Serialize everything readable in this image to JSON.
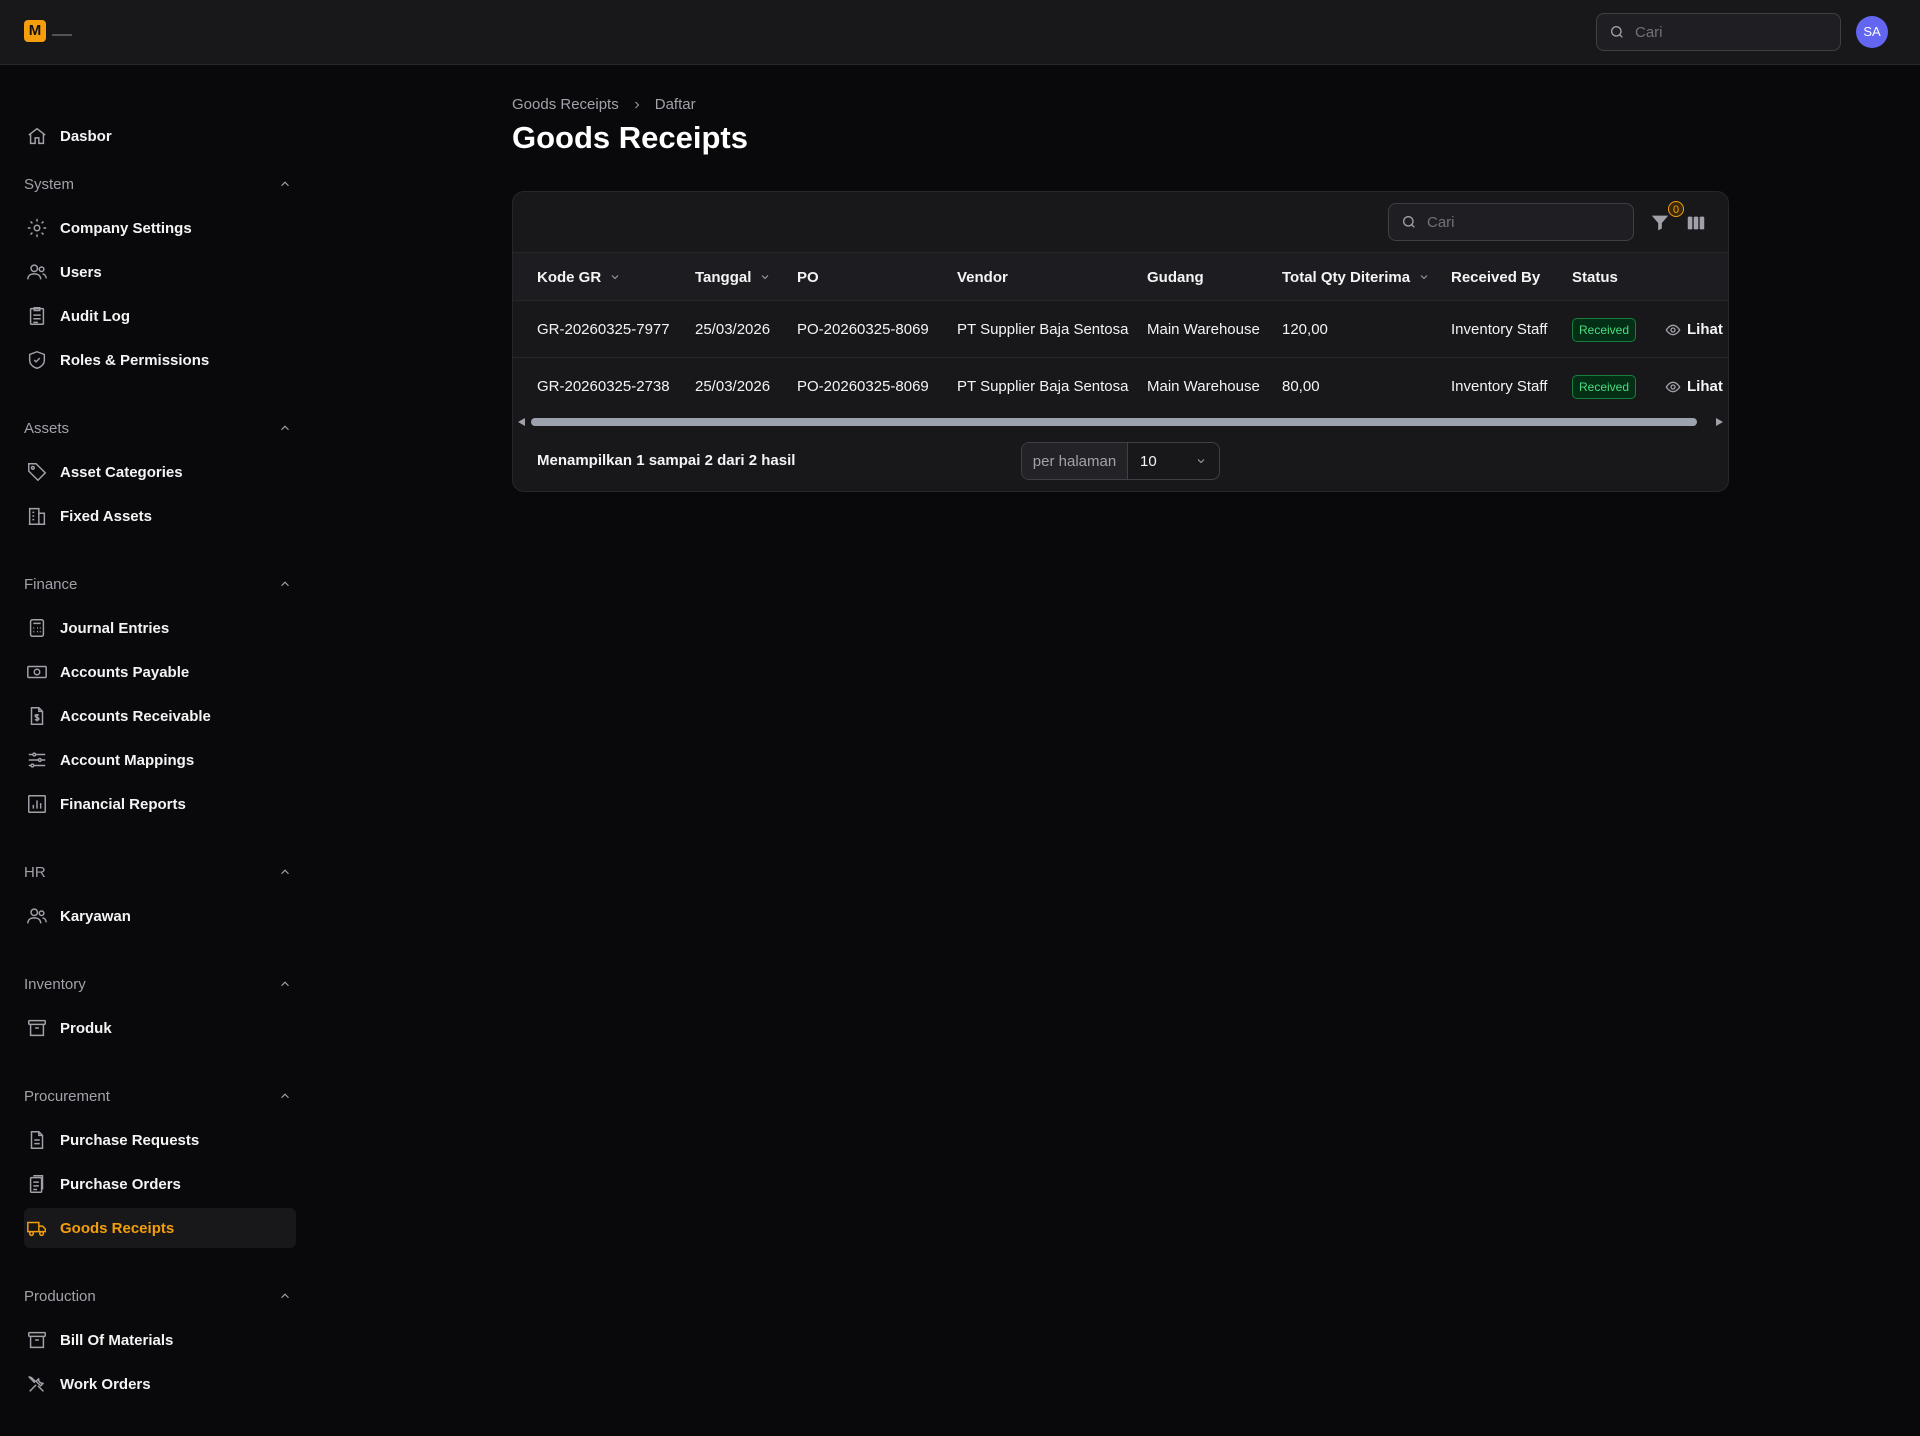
{
  "app": {
    "logo_letter": "M",
    "avatar_initials": "SA",
    "search_placeholder": "Cari"
  },
  "sidebar": {
    "dashboard": "Dasbor",
    "groups": [
      {
        "label": "System",
        "items": [
          "Company Settings",
          "Users",
          "Audit Log",
          "Roles & Permissions"
        ]
      },
      {
        "label": "Assets",
        "items": [
          "Asset Categories",
          "Fixed Assets"
        ]
      },
      {
        "label": "Finance",
        "items": [
          "Journal Entries",
          "Accounts Payable",
          "Accounts Receivable",
          "Account Mappings",
          "Financial Reports"
        ]
      },
      {
        "label": "HR",
        "items": [
          "Karyawan"
        ]
      },
      {
        "label": "Inventory",
        "items": [
          "Produk"
        ]
      },
      {
        "label": "Procurement",
        "items": [
          "Purchase Requests",
          "Purchase Orders",
          "Goods Receipts"
        ]
      },
      {
        "label": "Production",
        "items": [
          "Bill Of Materials",
          "Work Orders"
        ]
      }
    ],
    "active_item": "Goods Receipts"
  },
  "breadcrumb": {
    "parent": "Goods Receipts",
    "current": "Daftar"
  },
  "page": {
    "title": "Goods Receipts"
  },
  "table": {
    "search_placeholder": "Cari",
    "filter_count": "0",
    "columns": [
      "Kode GR",
      "Tanggal",
      "PO",
      "Vendor",
      "Gudang",
      "Total Qty Diterima",
      "Received By",
      "Status"
    ],
    "rows": [
      {
        "kode_gr": "GR-20260325-7977",
        "tanggal": "25/03/2026",
        "po": "PO-20260325-8069",
        "vendor": "PT Supplier Baja Sentosa",
        "gudang": "Main Warehouse",
        "total_qty": "120,00",
        "received_by": "Inventory Staff",
        "status": "Received",
        "action": "Lihat"
      },
      {
        "kode_gr": "GR-20260325-2738",
        "tanggal": "25/03/2026",
        "po": "PO-20260325-8069",
        "vendor": "PT Supplier Baja Sentosa",
        "gudang": "Main Warehouse",
        "total_qty": "80,00",
        "received_by": "Inventory Staff",
        "status": "Received",
        "action": "Lihat"
      }
    ],
    "footer_text": "Menampilkan 1 sampai 2 dari 2 hasil",
    "per_page_label": "per halaman",
    "per_page_value": "10"
  },
  "colors": {
    "accent": "#f59e0b",
    "status_success": "#4ade80",
    "avatar": "#6366f1"
  }
}
